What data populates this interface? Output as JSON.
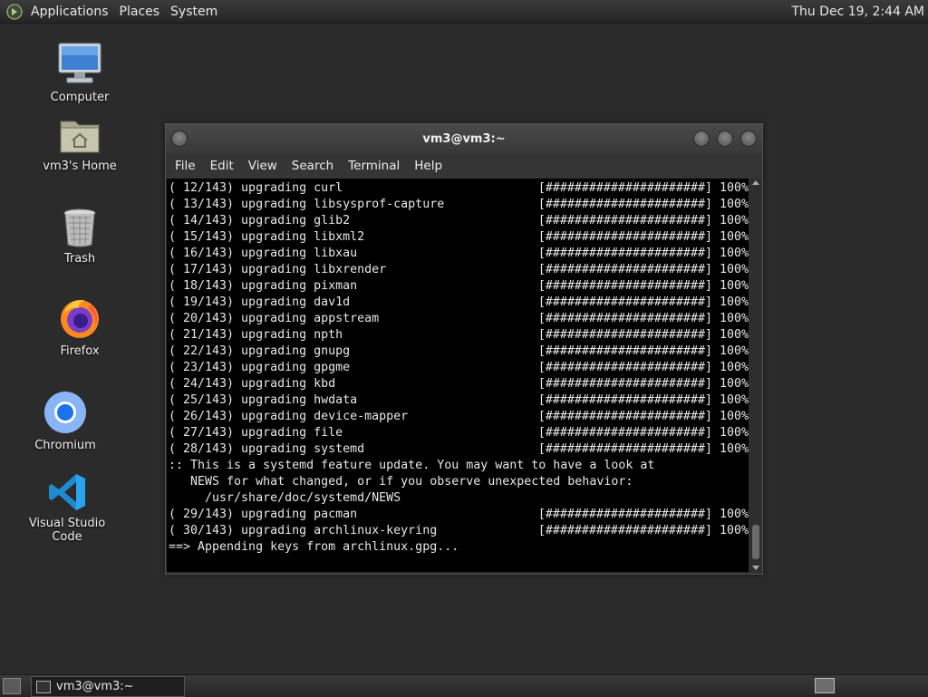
{
  "top_panel": {
    "menus": [
      "Applications",
      "Places",
      "System"
    ],
    "clock": "Thu Dec 19,  2:44 AM"
  },
  "desktop": {
    "icons": [
      {
        "label": "Computer",
        "icon": "computer-icon"
      },
      {
        "label": "vm3's Home",
        "icon": "home-folder-icon"
      },
      {
        "label": "Trash",
        "icon": "trash-icon"
      },
      {
        "label": "Firefox",
        "icon": "firefox-icon"
      },
      {
        "label": "Chromium",
        "icon": "chromium-icon"
      },
      {
        "label": "Visual Studio Code",
        "icon": "vscode-icon"
      }
    ]
  },
  "terminal": {
    "title": "vm3@vm3:~",
    "menu": [
      "File",
      "Edit",
      "View",
      "Search",
      "Terminal",
      "Help"
    ],
    "progress_lines": [
      {
        "left": "( 12/143) upgrading curl",
        "bar": "[######################]",
        "pct": "100%"
      },
      {
        "left": "( 13/143) upgrading libsysprof-capture",
        "bar": "[######################]",
        "pct": "100%"
      },
      {
        "left": "( 14/143) upgrading glib2",
        "bar": "[######################]",
        "pct": "100%"
      },
      {
        "left": "( 15/143) upgrading libxml2",
        "bar": "[######################]",
        "pct": "100%"
      },
      {
        "left": "( 16/143) upgrading libxau",
        "bar": "[######################]",
        "pct": "100%"
      },
      {
        "left": "( 17/143) upgrading libxrender",
        "bar": "[######################]",
        "pct": "100%"
      },
      {
        "left": "( 18/143) upgrading pixman",
        "bar": "[######################]",
        "pct": "100%"
      },
      {
        "left": "( 19/143) upgrading dav1d",
        "bar": "[######################]",
        "pct": "100%"
      },
      {
        "left": "( 20/143) upgrading appstream",
        "bar": "[######################]",
        "pct": "100%"
      },
      {
        "left": "( 21/143) upgrading npth",
        "bar": "[######################]",
        "pct": "100%"
      },
      {
        "left": "( 22/143) upgrading gnupg",
        "bar": "[######################]",
        "pct": "100%"
      },
      {
        "left": "( 23/143) upgrading gpgme",
        "bar": "[######################]",
        "pct": "100%"
      },
      {
        "left": "( 24/143) upgrading kbd",
        "bar": "[######################]",
        "pct": "100%"
      },
      {
        "left": "( 25/143) upgrading hwdata",
        "bar": "[######################]",
        "pct": "100%"
      },
      {
        "left": "( 26/143) upgrading device-mapper",
        "bar": "[######################]",
        "pct": "100%"
      },
      {
        "left": "( 27/143) upgrading file",
        "bar": "[######################]",
        "pct": "100%"
      },
      {
        "left": "( 28/143) upgrading systemd",
        "bar": "[######################]",
        "pct": "100%"
      }
    ],
    "notice_lines": [
      ":: This is a systemd feature update. You may want to have a look at",
      "   NEWS for what changed, or if you observe unexpected behavior:",
      "     /usr/share/doc/systemd/NEWS"
    ],
    "progress_lines_2": [
      {
        "left": "( 29/143) upgrading pacman",
        "bar": "[######################]",
        "pct": "100%"
      },
      {
        "left": "( 30/143) upgrading archlinux-keyring",
        "bar": "[######################]",
        "pct": "100%"
      }
    ],
    "last_line": "==> Appending keys from archlinux.gpg..."
  },
  "bottom_panel": {
    "task_label": "vm3@vm3:~"
  }
}
